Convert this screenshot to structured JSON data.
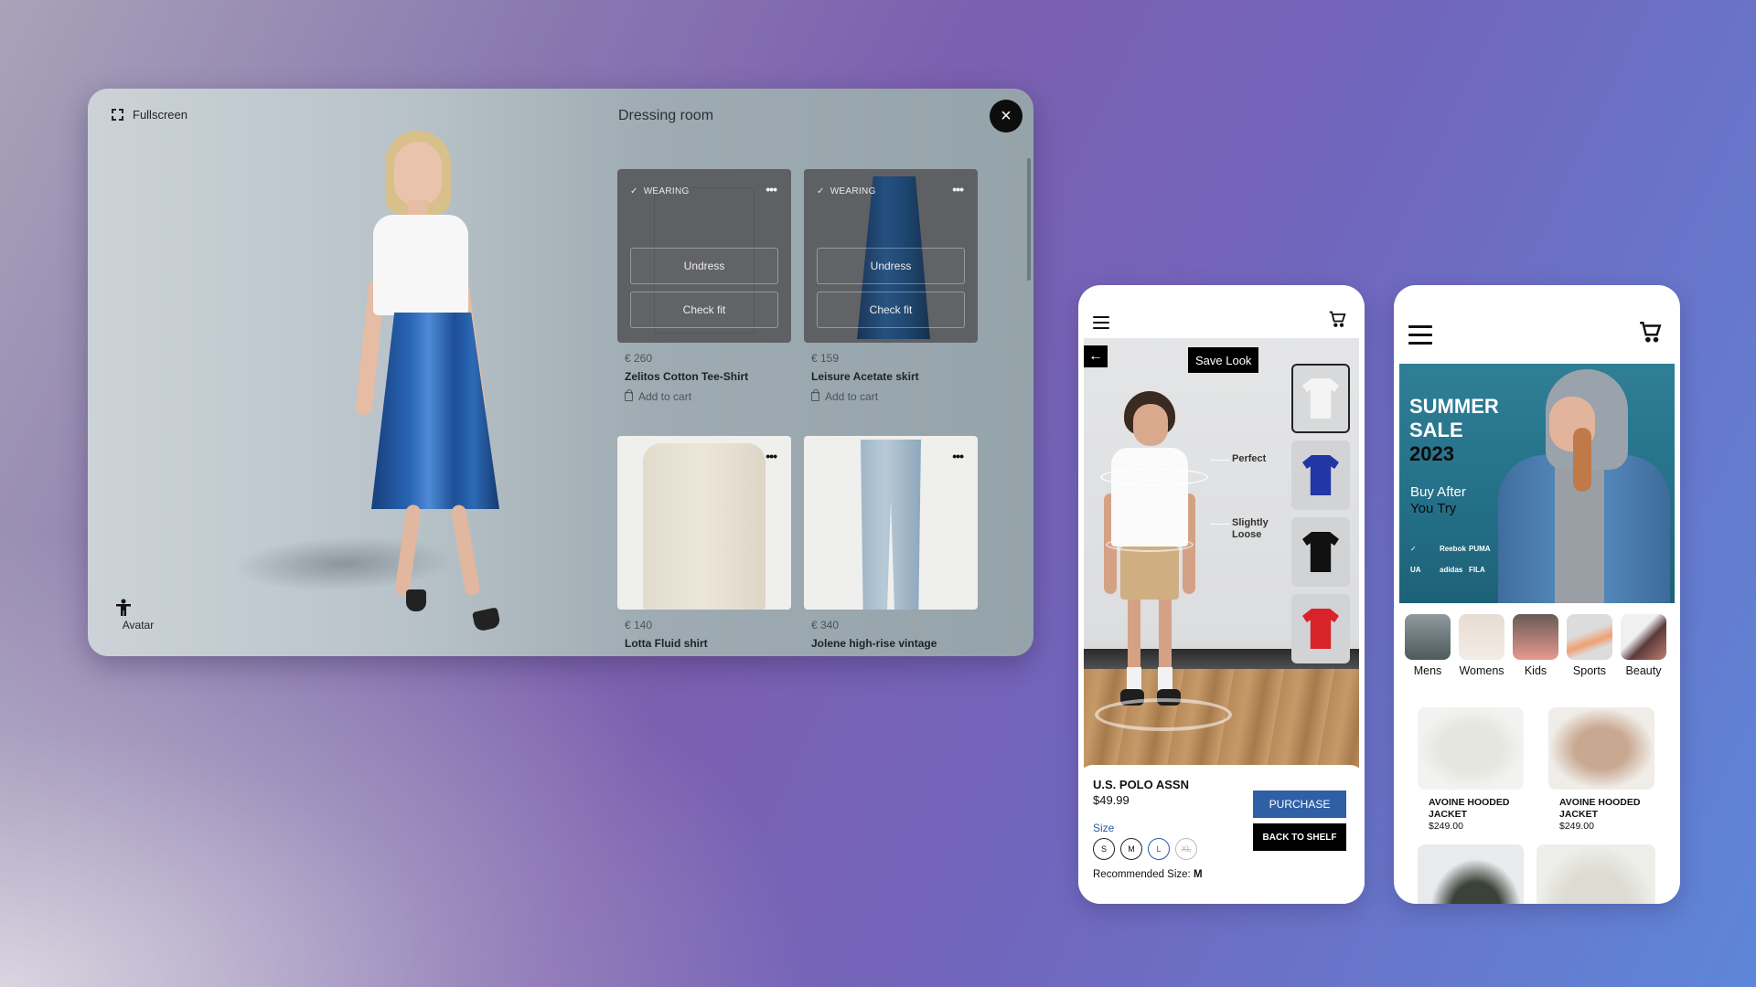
{
  "dressing_room": {
    "fullscreen_label": "Fullscreen",
    "title": "Dressing room",
    "close_icon": "×",
    "avatar_label": "Avatar",
    "avatar_icon": "🚹",
    "products": [
      {
        "price": "€ 260",
        "name": "Zelitos Cotton Tee-Shirt",
        "status": "WEARING",
        "undress_label": "Undress",
        "check_fit_label": "Check fit",
        "add_to_cart_label": "Add to cart"
      },
      {
        "price": "€ 159",
        "name": "Leisure Acetate skirt",
        "status": "WEARING",
        "undress_label": "Undress",
        "check_fit_label": "Check fit",
        "add_to_cart_label": "Add to cart"
      },
      {
        "price": "€ 140",
        "name": "Lotta Fluid shirt"
      },
      {
        "price": "€ 340",
        "name": "Jolene high-rise vintage"
      }
    ],
    "more_icon": "•••",
    "check_icon": "✓"
  },
  "phone_tryon": {
    "back_icon": "←",
    "save_look_label": "Save Look",
    "fit_labels": [
      "Perfect",
      "Slightly Loose"
    ],
    "swatch_colors": [
      "#f4f4f4",
      "#2236a6",
      "#111111",
      "#d8232a"
    ],
    "brand": "U.S. POLO ASSN",
    "price": "$49.99",
    "size_label": "Size",
    "sizes": [
      "S",
      "M",
      "L",
      "XL"
    ],
    "selected_size": "L",
    "unavailable_size": "XL",
    "recommended_label": "Recommended Size:",
    "recommended_size": "M",
    "purchase_label": "PURCHASE",
    "back_to_shelf_label": "BACK TO SHELF",
    "accent_color": "#2f5fa5"
  },
  "phone_shop": {
    "banner": {
      "line1": "SUMMER",
      "line2": "SALE",
      "year": "2023",
      "sub1": "Buy After",
      "sub2": "You Try",
      "brands": [
        "Nike",
        "Reebok",
        "PUMA",
        "Under Armour",
        "adidas",
        "FILA"
      ]
    },
    "categories": [
      "Mens",
      "Womens",
      "Kids",
      "Sports",
      "Beauty"
    ],
    "products": [
      {
        "name": "AVOINE HOODED JACKET",
        "price": "$249.00"
      },
      {
        "name": "AVOINE HOODED JACKET",
        "price": "$249.00"
      }
    ]
  }
}
